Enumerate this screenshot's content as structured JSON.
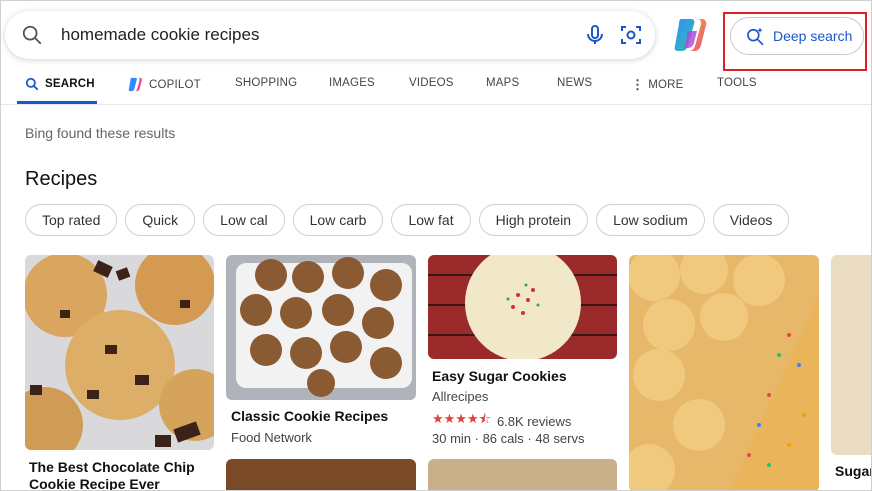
{
  "search": {
    "query": "homemade cookie recipes"
  },
  "deep_search": {
    "label": "Deep search"
  },
  "tabs": [
    {
      "label": "SEARCH"
    },
    {
      "label": "COPILOT"
    },
    {
      "label": "SHOPPING"
    },
    {
      "label": "IMAGES"
    },
    {
      "label": "VIDEOS"
    },
    {
      "label": "MAPS"
    },
    {
      "label": "NEWS"
    },
    {
      "label": "MORE"
    },
    {
      "label": "TOOLS"
    }
  ],
  "results_note": "Bing found these results",
  "recipes": {
    "title": "Recipes",
    "filters": [
      "Top rated",
      "Quick",
      "Low cal",
      "Low carb",
      "Low fat",
      "High protein",
      "Low sodium",
      "Videos"
    ],
    "cards": [
      {
        "title": "The Best Chocolate Chip Cookie Recipe Ever"
      },
      {
        "title": "Classic Cookie Recipes",
        "source": "Food Network"
      },
      {
        "title": "Easy Sugar Cookies",
        "source": "Allrecipes",
        "rating": 4.5,
        "reviews": "6.8K reviews",
        "meta": "30 min · 86 cals · 48 servs"
      },
      {
        "title": ""
      },
      {
        "title": "Sugar"
      }
    ]
  },
  "colors": {
    "accent": "#1a57c8",
    "highlight_box": "#e02020",
    "star": "#e0403a"
  }
}
